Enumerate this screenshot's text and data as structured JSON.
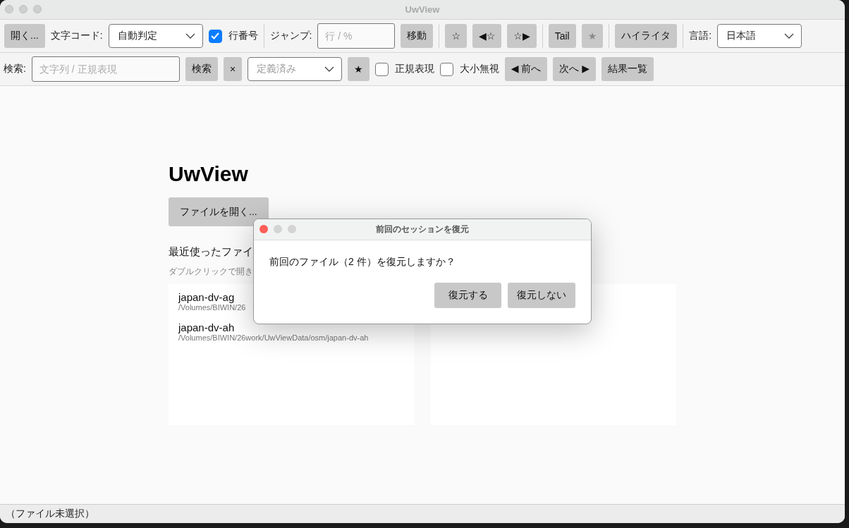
{
  "window": {
    "title": "UwView"
  },
  "toolbar_rows": [
    {
      "items": [
        {
          "kind": "button",
          "label": "開く...",
          "disabled": false
        },
        {
          "kind": "label",
          "text": "文字コード:"
        },
        {
          "kind": "select",
          "value": "自動判定"
        },
        {
          "kind": "checkbox",
          "label": "行番号",
          "checked": true
        },
        {
          "kind": "separator"
        },
        {
          "kind": "label",
          "text": "ジャンプ:"
        },
        {
          "kind": "input",
          "placeholder": "行 / %"
        },
        {
          "kind": "button",
          "label": "移動",
          "disabled": false
        },
        {
          "kind": "separator"
        },
        {
          "kind": "button",
          "label": "☆",
          "disabled": false
        },
        {
          "kind": "button",
          "label": "◀☆",
          "disabled": false
        },
        {
          "kind": "button",
          "label": "☆▶",
          "disabled": false
        },
        {
          "kind": "separator"
        },
        {
          "kind": "button",
          "label": "Tail",
          "disabled": false
        },
        {
          "kind": "button",
          "label": "★",
          "disabled": true
        },
        {
          "kind": "separator"
        },
        {
          "kind": "button",
          "label": "ハイライタ",
          "disabled": false
        },
        {
          "kind": "separator"
        },
        {
          "kind": "label",
          "text": "言語:"
        },
        {
          "kind": "select",
          "value": "日本語"
        }
      ]
    },
    {
      "items": [
        {
          "kind": "label",
          "text": "検索:"
        },
        {
          "kind": "input",
          "placeholder": "文字列 / 正規表現"
        },
        {
          "kind": "button",
          "label": "検索",
          "disabled": false
        },
        {
          "kind": "button",
          "label": "×",
          "disabled": false
        },
        {
          "kind": "select",
          "placeholder": "定義済み"
        },
        {
          "kind": "button",
          "label": "★",
          "disabled": false
        },
        {
          "kind": "checkbox",
          "label": "正規表現",
          "checked": false
        },
        {
          "kind": "checkbox",
          "label": "大小無視",
          "checked": false
        },
        {
          "kind": "button",
          "label": "◀ 前へ",
          "disabled": false
        },
        {
          "kind": "button",
          "label": "次へ ▶",
          "disabled": false
        },
        {
          "kind": "button",
          "label": "結果一覧",
          "disabled": false
        }
      ]
    }
  ],
  "main": {
    "title": "UwView",
    "open_button": "ファイルを開く...",
    "recent_heading": "最近使ったファイ",
    "recent_hint": "ダブルクリックで開き",
    "recent_files": [
      {
        "name": "japan-dv-ag",
        "path": "/Volumes/BIWIN/26"
      },
      {
        "name": "japan-dv-ah",
        "path": "/Volumes/BIWIN/26work/UwViewData/osm/japan-dv-ah"
      }
    ]
  },
  "dialog": {
    "title": "前回のセッションを復元",
    "message": "前回のファイル（2 件）を復元しますか？",
    "buttons": [
      "復元する",
      "復元しない"
    ]
  },
  "status_bar": "（ファイル未選択）"
}
